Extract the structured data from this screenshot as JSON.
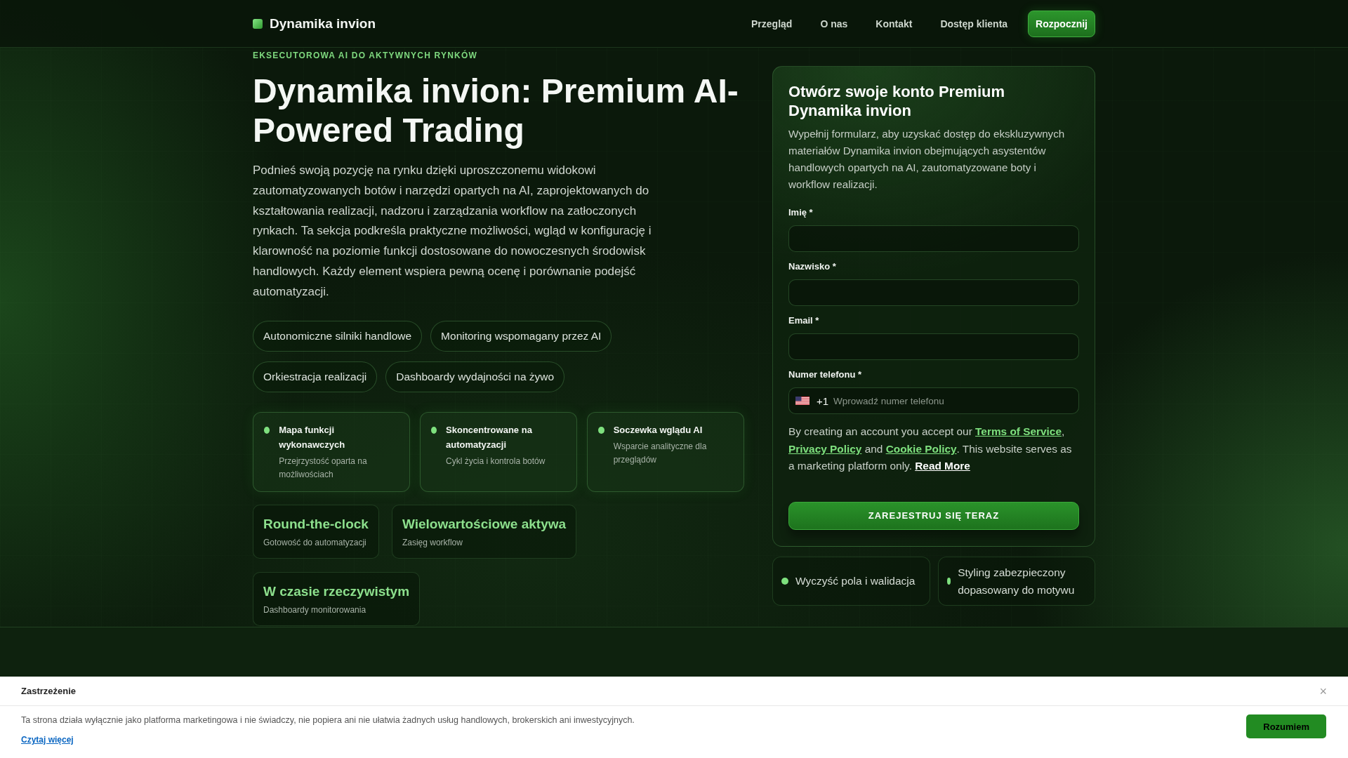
{
  "header": {
    "brand": "Dynamika invion",
    "nav": [
      "Przegląd",
      "O nas",
      "Kontakt",
      "Dostęp klienta"
    ],
    "cta": "Rozpocznij"
  },
  "hero": {
    "eyebrow": "EKSECUTOROWA AI DO AKTYWNYCH RYNKÓW",
    "title": "Dynamika invion: Premium AI-Powered Trading",
    "description": "Podnieś swoją pozycję na rynku dzięki uproszczonemu widokowi zautomatyzowanych botów i narzędzi opartych na AI, zaprojektowanych do kształtowania realizacji, nadzoru i zarządzania workflow na zatłoczonych rynkach. Ta sekcja podkreśla praktyczne możliwości, wgląd w konfigurację i klarowność na poziomie funkcji dostosowane do nowoczesnych środowisk handlowych. Każdy element wspiera pewną ocenę i porównanie podejść automatyzacji.",
    "tags": [
      "Autonomiczne silniki handlowe",
      "Monitoring wspomagany przez AI",
      "Orkiestracja realizacji",
      "Dashboardy wydajności na żywo"
    ],
    "features": [
      {
        "title": "Mapa funkcji wykonawczych",
        "description": "Przejrzystość oparta na możliwościach"
      },
      {
        "title": "Skoncentrowane na automatyzacji",
        "description": "Cykl życia i kontrola botów"
      },
      {
        "title": "Soczewka wglądu AI",
        "description": "Wsparcie analityczne dla przeglądów"
      }
    ],
    "stats": [
      {
        "value": "Round-the-clock",
        "label": "Gotowość do automatyzacji"
      },
      {
        "value": "Wielowartościowe aktywa",
        "label": "Zasięg workflow"
      },
      {
        "value": "W czasie rzeczywistym",
        "label": "Dashboardy monitorowania"
      }
    ]
  },
  "signup": {
    "title": "Otwórz swoje konto Premium Dynamika invion",
    "description": "Wypełnij formularz, aby uzyskać dostęp do ekskluzywnych materiałów Dynamika invion obejmujących asystentów handlowych opartych na AI, zautomatyzowane boty i workflow realizacji.",
    "fields": [
      {
        "kind": "text",
        "label": "Imię *"
      },
      {
        "kind": "text",
        "label": "Nazwisko *"
      },
      {
        "kind": "email",
        "label": "Email *"
      },
      {
        "kind": "phone",
        "label": "Numer telefonu *",
        "dial_code": "+1",
        "placeholder": "Wprowadź numer telefonu"
      }
    ],
    "legal": [
      {
        "kind": "text",
        "text": "By creating an account you accept our "
      },
      {
        "kind": "link",
        "text": "Terms of Service"
      },
      {
        "kind": "text",
        "text": ", "
      },
      {
        "kind": "link",
        "text": "Privacy Policy"
      },
      {
        "kind": "text",
        "text": " and "
      },
      {
        "kind": "link",
        "text": "Cookie Policy"
      },
      {
        "kind": "text",
        "text": ". This website serves as a marketing platform only. "
      },
      {
        "kind": "more",
        "text": "Read More"
      }
    ],
    "submit": "ZAREJESTRUJ SIĘ TERAZ"
  },
  "form_notes": [
    "Wyczyść pola i walidacja",
    "Styling zabezpieczony dopasowany do motywu"
  ],
  "disclaimer": {
    "title": "Zastrzeżenie",
    "close": "×",
    "text": "Ta strona działa wyłącznie jako platforma marketingowa i nie świadczy, nie popiera ani nie ułatwia żadnych usług handlowych, brokerskich ani inwestycyjnych.",
    "link": "Czytaj więcej",
    "button": "Rozumiem"
  }
}
